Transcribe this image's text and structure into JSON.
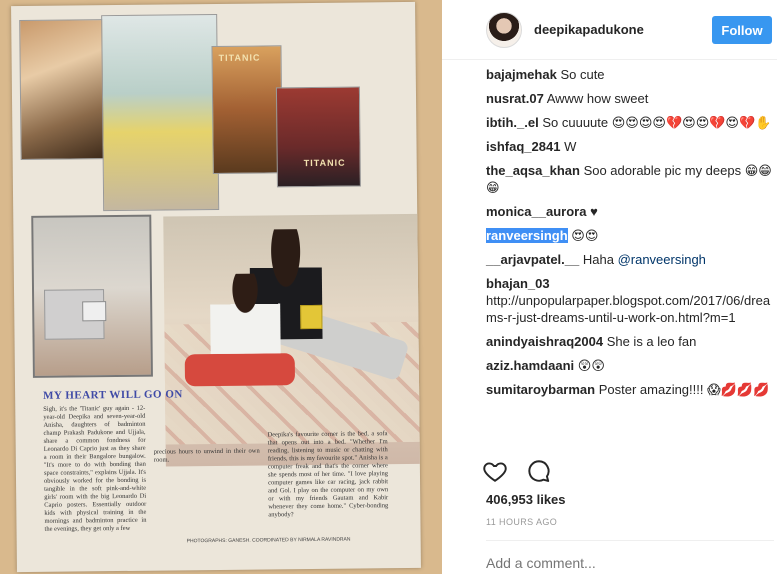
{
  "post": {
    "header": {
      "username": "deepikapadukone",
      "follow_label": "Follow"
    },
    "image": {
      "poster_text_1": "TITANIC",
      "poster_text_2": "TITANIC",
      "article_title": "MY HEART WILL GO ON",
      "article_col_1": "Sigh, it's the 'Titanic' guy again - 12-year-old Deepika and seven-year-old Anisha, daughters of badminton champ Prakash Padukone and Ujjala, share a common fondness for Leonardo Di Caprio just as they share a room in their Bangalore bungalow. \"It's more to do with bonding than space constraints,\" explains Ujjala. It's obviously worked for the bonding is tangible in the soft pink-and-white girls' room with the big Leonardo Di Caprio posters. Essentially outdoor kids with physical training in the mornings and badminton practice in the evenings, they get only a few",
      "article_col_2": "precious hours to unwind in their own room.",
      "article_col_3": "Deepika's favourite corner is the bed, a sofa that opens out into a bed. \"Whether I'm reading, listening to music or chatting with friends, this is my favourite spot.\" Anisha is a computer freak and that's the corner where she spends most of her time. \"I love playing computer games like car racing, jack rabbit and Gol. I play on the computer on my own or with my friends Gautam and Kabir whenever they come home.\" Cyber-bonding anybody?",
      "credit": "PHOTOGRAPHS: GANESH. COORDINATED BY NIRMALA RAVINDRAN"
    },
    "comments": [
      {
        "user": "bajajmehak",
        "text": "So cute"
      },
      {
        "user": "nusrat.07",
        "text": "Awww how sweet"
      },
      {
        "user": "ibtih._.el",
        "text": "So cuuuute 😍😍😍😍💔😍😍💔😍💔✋"
      },
      {
        "user": "ishfaq_2841",
        "text": "W"
      },
      {
        "user": "the_aqsa_khan",
        "text": "Soo adorable pic my deeps 😁😁😁"
      },
      {
        "user": "monica__aurora",
        "text": "♥"
      },
      {
        "user": "ranveersingh",
        "text": "😍😍"
      },
      {
        "user": "__arjavpatel.__",
        "text": "Haha",
        "mention": "@ranveersingh"
      },
      {
        "user": "bhajan_03",
        "text": "http://unpopularpaper.blogspot.com/2017/06/dreams-r-just-dreams-until-u-work-on.html?m=1"
      },
      {
        "user": "anindyaishraq2004",
        "text": "She is a leo fan"
      },
      {
        "user": "aziz.hamdaani",
        "text": "😲😲"
      },
      {
        "user": "sumitaroybarman",
        "text": "Poster amazing!!!! 😱💋💋💋"
      }
    ],
    "likes": "406,953 likes",
    "time": "11 HOURS AGO",
    "add_comment_placeholder": "Add a comment..."
  },
  "colors": {
    "follow_button": "#3897f0",
    "mention": "#003569",
    "highlight": "#3f8ff5",
    "muted": "#999999"
  },
  "icons": [
    "heart-icon",
    "comment-bubble-icon"
  ]
}
